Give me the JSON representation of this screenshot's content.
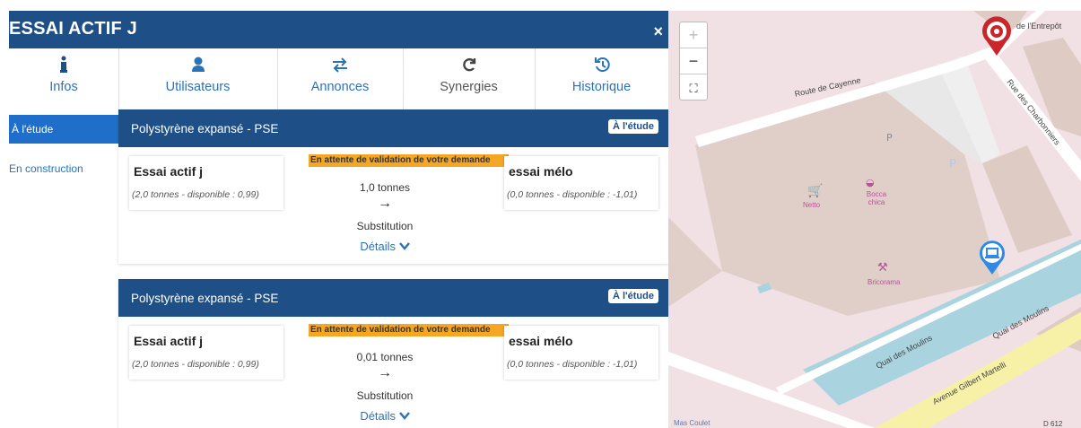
{
  "window": {
    "title": "ESSAI ACTIF J",
    "close_symbol": "×"
  },
  "tabs": [
    {
      "label": "Infos",
      "icon": "info-icon"
    },
    {
      "label": "Utilisateurs",
      "icon": "user-icon"
    },
    {
      "label": "Annonces",
      "icon": "exchange-arrows-icon"
    },
    {
      "label": "Synergies",
      "icon": "refresh-icon"
    },
    {
      "label": "Historique",
      "icon": "history-icon"
    }
  ],
  "sidebar": {
    "active": "À l'étude",
    "items": [
      "En construction"
    ]
  },
  "cards": [
    {
      "title": "Polystyrène expansé - PSE",
      "status": "À l'étude",
      "pending": "En attente de validation de votre demande",
      "from": {
        "name": "Essai actif j",
        "info": "(2,0 tonnes - disponible : 0,99)"
      },
      "to": {
        "name": "essai mélo",
        "info": "(0,0 tonnes - disponible : -1,01)"
      },
      "quantity": "1,0 tonnes",
      "arrow": "→",
      "type": "Substitution",
      "details": "Détails"
    },
    {
      "title": "Polystyrène expansé - PSE",
      "status": "À l'étude",
      "pending": "En attente de validation de votre demande",
      "from": {
        "name": "Essai actif j",
        "info": "(2,0 tonnes - disponible : 0,99)"
      },
      "to": {
        "name": "essai mélo",
        "info": "(0,0 tonnes - disponible : -1,01)"
      },
      "quantity": "0,01 tonnes",
      "arrow": "→",
      "type": "Substitution",
      "details": "Détails"
    }
  ],
  "map": {
    "zoom_in": "+",
    "zoom_out": "−",
    "fullscreen_symbol": "⛶",
    "labels": [
      "de l'Entrepôt",
      "Route de Cayenne",
      "Rue des Charbonniers",
      "Netto",
      "Bocca chica",
      "Bricorama",
      "Quai des Moulins",
      "Quai des Moulins",
      "Avenue Gilbert Martelli",
      "Mas Coulet",
      "D 612"
    ]
  },
  "colors": {
    "header": "#1e4f86",
    "accent": "#1f6fca",
    "link": "#2a73b8",
    "pending": "#f5a623",
    "map_bg": "#f1e1e4",
    "canal": "#a9d3df",
    "road_yellow": "#f7f1a8"
  }
}
